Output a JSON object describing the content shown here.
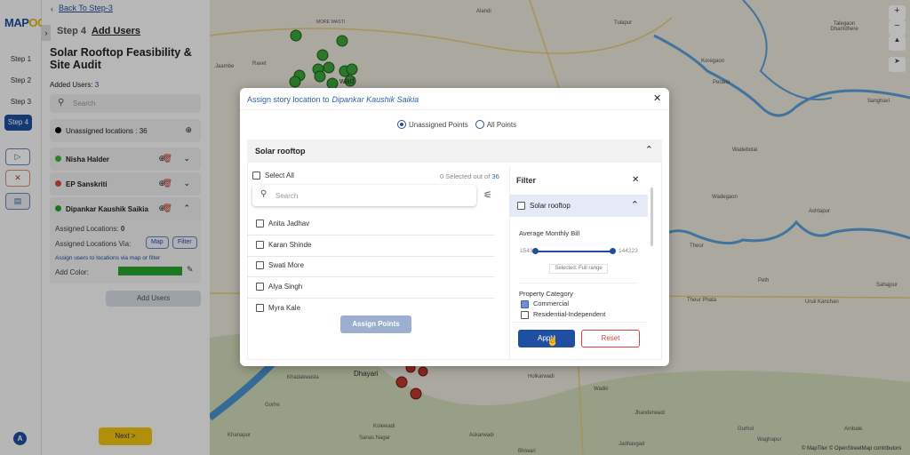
{
  "brand": {
    "logo_a": "MAP",
    "logo_b": "OG"
  },
  "rail": {
    "steps": [
      "Step 1",
      "Step 2",
      "Step 3",
      "Step 4"
    ],
    "active_step": "Step 4",
    "avatar": "A"
  },
  "sidebar": {
    "back_link": "Back To Step-3",
    "step_label": "Step 4",
    "step_title": "Add Users",
    "project_title": "Solar Rooftop Feasibility & Site Audit",
    "added_users_label": "Added Users:",
    "added_users_count": "3",
    "search_placeholder": "Search",
    "unassigned": "Unassigned locations : 36",
    "users": [
      {
        "name": "Nisha Halder",
        "color": "#3cb043"
      },
      {
        "name": "EP Sanskriti",
        "color": "#d9453c"
      },
      {
        "name": "Dipankar Kaushik Saikia",
        "color": "#22a32a"
      }
    ],
    "expanded": {
      "assigned_label": "Assigned Locations:",
      "assigned_count": "0",
      "via_label": "Assigned Locations Via:",
      "map_btn": "Map",
      "filter_btn": "Filter",
      "hint": "Assign users to locations via map or filter",
      "color_label": "Add Color:",
      "color": "#2aa52f"
    },
    "add_users_btn": "Add Users",
    "next_btn": "Next >"
  },
  "map": {
    "labels": [
      "Alandi",
      "Tulapur",
      "Talegaon Dhamdhere",
      "MORE WASTI",
      "Jaambe",
      "Ravet",
      "Koregaon",
      "Perane",
      "Wadebolai",
      "Wadegaon",
      "Ashtapur",
      "Theur",
      "Peth",
      "Theur Phata",
      "Uruli Kanchan",
      "Sahajpur",
      "Sanghavi",
      "Dhayari",
      "Khadakwasla",
      "Gorhe",
      "Khanapur",
      "Kolewadi",
      "Sanas Nagar",
      "Askarwadi",
      "Holkarwadi",
      "Wadki",
      "Jhanderwadi",
      "Jadhavgad",
      "Bhiwari",
      "Gurhol",
      "Ambale",
      "Waghapur",
      "wad"
    ],
    "attribution": "© MapTiler © OpenStreetMap contributors",
    "controls": [
      "+",
      "−",
      "▲",
      "➤"
    ]
  },
  "modal": {
    "title_prefix": "Assign story location to",
    "title_user": "Dipankar Kaushik Saikia",
    "radio": [
      {
        "label": "Unassigned Points",
        "selected": true
      },
      {
        "label": "All Points",
        "selected": false
      }
    ],
    "section": "Solar rooftop",
    "select_all": "Select All",
    "selected_count": "0",
    "selected_mid": "Selected out of",
    "selected_total": "36",
    "search_placeholder": "Search",
    "items": [
      "Anita Jadhav",
      "Karan Shinde",
      "Swati More",
      "Alya Singh",
      "Myra Kale"
    ],
    "assign_btn": "Assign Points",
    "filter": {
      "title": "Filter",
      "layer": "Solar rooftop",
      "bill_label": "Average Monthly Bill",
      "min": "1543",
      "max": "144223",
      "range_fraction": [
        0,
        1
      ],
      "selected_range": "Selected: Full range",
      "category_label": "Property Category",
      "categories": [
        {
          "label": "Commercial",
          "checked": true
        },
        {
          "label": "Residential-Independent",
          "checked": false
        }
      ],
      "apply": "Apply",
      "reset": "Reset"
    }
  }
}
